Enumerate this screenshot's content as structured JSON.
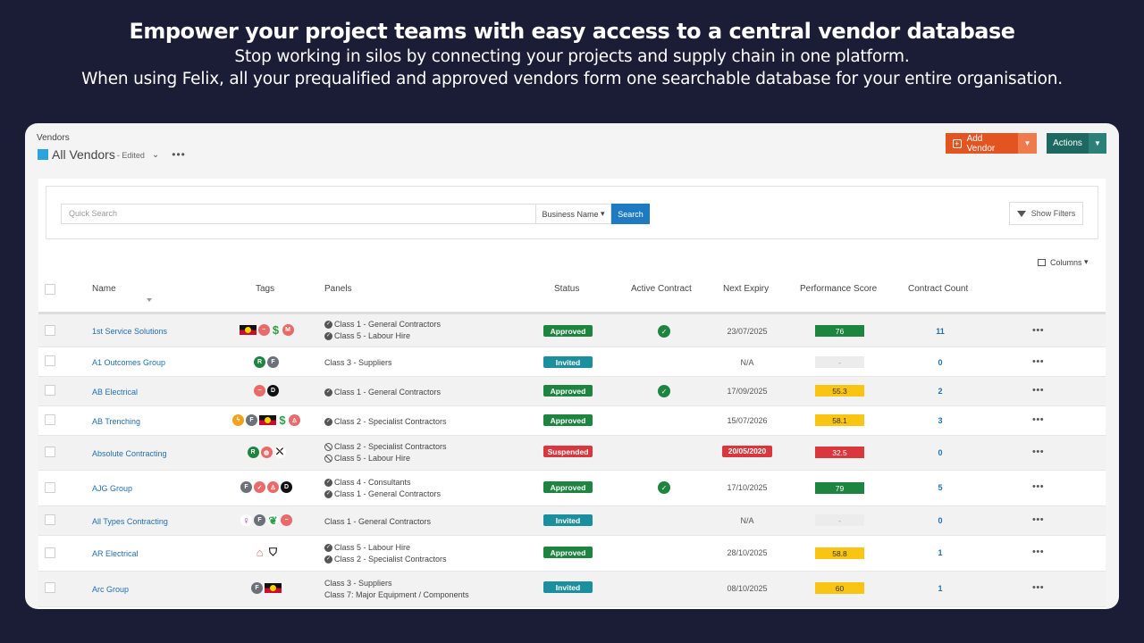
{
  "hero": {
    "title": "Empower your project teams with easy access to a central vendor database",
    "line1": "Stop working in silos by connecting your projects and supply chain in one platform.",
    "line2": "When using Felix, all your prequalified and approved vendors form one searchable database for your entire organisation."
  },
  "header": {
    "breadcrumb": "Vendors",
    "view_title": "All Vendors",
    "edited": "- Edited",
    "add_vendor": "Add Vendor",
    "actions": "Actions"
  },
  "search": {
    "placeholder": "Quick Search",
    "field": "Business Name",
    "button": "Search",
    "filters": "Show Filters"
  },
  "columns_label": "Columns",
  "table": {
    "headers": {
      "name": "Name",
      "tags": "Tags",
      "panels": "Panels",
      "status": "Status",
      "active_contract": "Active Contract",
      "next_expiry": "Next Expiry",
      "performance": "Performance Score",
      "contract_count": "Contract Count"
    },
    "rows": [
      {
        "name": "1st Service Solutions",
        "panels": [
          "Class 1 - General Contractors",
          "Class 5 - Labour Hire"
        ],
        "status": "Approved",
        "active": true,
        "expiry": "23/07/2025",
        "score": "76",
        "count": "11"
      },
      {
        "name": "A1 Outcomes Group",
        "panels": [
          "Class 3 - Suppliers"
        ],
        "status": "Invited",
        "active": false,
        "expiry": "N/A",
        "score": "-",
        "count": "0"
      },
      {
        "name": "AB Electrical",
        "panels": [
          "Class 1 - General Contractors"
        ],
        "status": "Approved",
        "active": true,
        "expiry": "17/09/2025",
        "score": "55.3",
        "count": "2"
      },
      {
        "name": "AB Trenching",
        "panels": [
          "Class 2 - Specialist Contractors"
        ],
        "status": "Approved",
        "active": false,
        "expiry": "15/07/2026",
        "score": "58.1",
        "count": "3"
      },
      {
        "name": "Absolute Contracting",
        "panels": [
          "Class 2 - Specialist Contractors",
          "Class 5 - Labour Hire"
        ],
        "status": "Suspended",
        "active": false,
        "expiry": "20/05/2020",
        "score": "32.5",
        "count": "0"
      },
      {
        "name": "AJG Group",
        "panels": [
          "Class 4 - Consultants",
          "Class 1 - General Contractors"
        ],
        "status": "Approved",
        "active": true,
        "expiry": "17/10/2025",
        "score": "79",
        "count": "5"
      },
      {
        "name": "All Types Contracting",
        "panels": [
          "Class 1 - General Contractors"
        ],
        "status": "Invited",
        "active": false,
        "expiry": "N/A",
        "score": "-",
        "count": "0"
      },
      {
        "name": "AR Electrical",
        "panels": [
          "Class 5 - Labour Hire",
          "Class 2 - Specialist Contractors"
        ],
        "status": "Approved",
        "active": false,
        "expiry": "28/10/2025",
        "score": "58.8",
        "count": "1"
      },
      {
        "name": "Arc Group",
        "panels": [
          "Class 3 - Suppliers",
          "Class 7: Major Equipment / Components"
        ],
        "status": "Invited",
        "active": false,
        "expiry": "08/10/2025",
        "score": "60",
        "count": "1"
      }
    ]
  },
  "tag_letters": {
    "R": "R",
    "F": "F",
    "D": "D",
    "M": "M"
  },
  "colors": {
    "accent_orange": "#e25420",
    "accent_teal": "#1d6961",
    "link_blue": "#1f6fb2",
    "approved": "#1e8540",
    "invited": "#1b8f9e",
    "suspended": "#d9363e"
  }
}
